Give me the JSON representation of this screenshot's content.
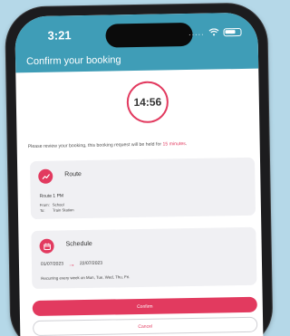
{
  "status_bar": {
    "time": "3:21",
    "dots": "....."
  },
  "header": {
    "title": "Confirm your booking"
  },
  "timer": {
    "value": "14:56"
  },
  "notice": {
    "prefix": "Please review your booking, this booking request will be held for ",
    "highlight": "15 minutes",
    "suffix": "."
  },
  "route_card": {
    "title": "Route",
    "route_name": "Route 1 PM",
    "from_label": "From:",
    "from_value": "School",
    "to_label": "To:",
    "to_value": "Train Station"
  },
  "schedule_card": {
    "title": "Schedule",
    "start_date": "01/07/2023",
    "end_date": "22/07/2023",
    "recurring": "Recurring every week on Mon, Tue, Wed, Thu, Fri."
  },
  "buttons": {
    "confirm": "Confirm",
    "cancel": "Cancel"
  },
  "colors": {
    "header": "#3f9db7",
    "accent": "#e23a5f",
    "card_bg": "#f0f0f3",
    "backdrop": "#b5d8e8"
  },
  "icons": [
    "wifi-icon",
    "battery-icon",
    "route-icon",
    "calendar-icon",
    "arrow-right-icon"
  ]
}
